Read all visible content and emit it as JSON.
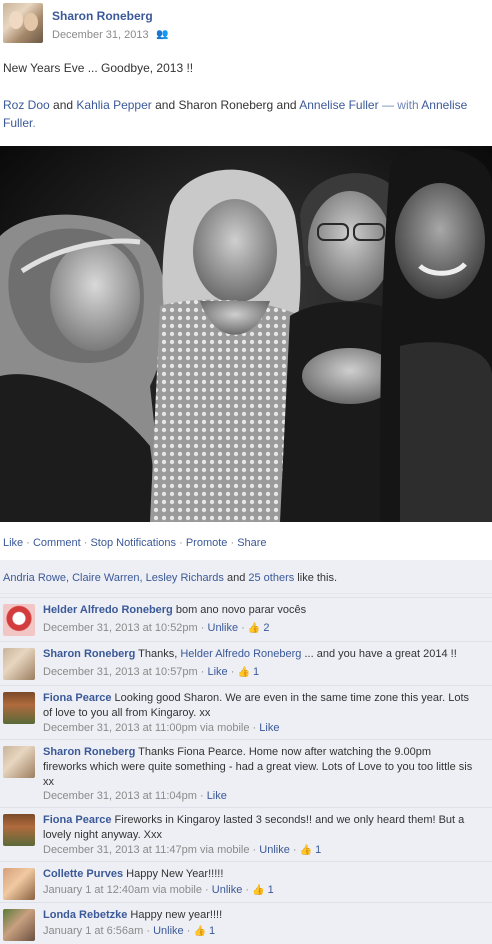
{
  "post": {
    "author": "Sharon Roneberg",
    "date": "December 31, 2013",
    "audience_icon": "friends-icon",
    "message": "New Years Eve ... Goodbye, 2013 !!",
    "tagged": {
      "person1": "Roz Doo",
      "and1": " and ",
      "person2": "Kahlia Pepper",
      "and2": " and Sharon Roneberg and ",
      "person3": "Annelise Fuller",
      "with": " — with ",
      "with_person": "Annelise Fuller",
      "period": "."
    },
    "photo_icon": "group-photo"
  },
  "actions": {
    "like": "Like",
    "comment": "Comment",
    "stop": "Stop Notifications",
    "promote": "Promote",
    "share": "Share",
    "sep": " · "
  },
  "likes": {
    "names": "Andria Rowe, Claire Warren, Lesley Richards",
    "and": " and ",
    "others": "25 others",
    "suffix": " like this."
  },
  "comments": [
    {
      "name": "Helder Alfredo Roneberg",
      "text": " bom ano novo parar vocês",
      "time": "December 31, 2013 at 10:52pm",
      "action": "Unlike",
      "likes": "2"
    },
    {
      "name": "Sharon Roneberg",
      "text_pre": " Thanks, ",
      "mention": "Helder Alfredo Roneberg",
      "text_post": " ... and you have a great 2014 !!",
      "time": "December 31, 2013 at 10:57pm",
      "action": "Like",
      "likes": "1"
    },
    {
      "name": "Fiona Pearce",
      "text": " Looking good Sharon. We are even in the same time zone this year. Lots of love to you all from Kingaroy. xx",
      "time": "December 31, 2013 at 11:00pm via mobile",
      "action": "Like"
    },
    {
      "name": "Sharon Roneberg",
      "text": " Thanks Fiona Pearce. Home now after watching the 9.00pm fireworks which were quite something - had a great view. Lots of Love to you too little sis xx",
      "time": "December 31, 2013 at 11:04pm",
      "action": "Like"
    },
    {
      "name": "Fiona Pearce",
      "text": " Fireworks in Kingaroy lasted 3 seconds!! and we only heard them! But a lovely night anyway. Xxx",
      "time": "December 31, 2013 at 11:47pm via mobile",
      "action": "Unlike",
      "likes": "1"
    },
    {
      "name": "Collette Purves",
      "text": " Happy New Year!!!!!",
      "time": "January 1 at 12:40am via mobile",
      "action": "Unlike",
      "likes": "1"
    },
    {
      "name": "Londa Rebetzke",
      "text": " Happy new year!!!!",
      "time": "January 1 at 6:56am",
      "action": "Unlike",
      "likes": "1"
    }
  ],
  "icons": {
    "thumb": "👍",
    "friends": "👥"
  }
}
